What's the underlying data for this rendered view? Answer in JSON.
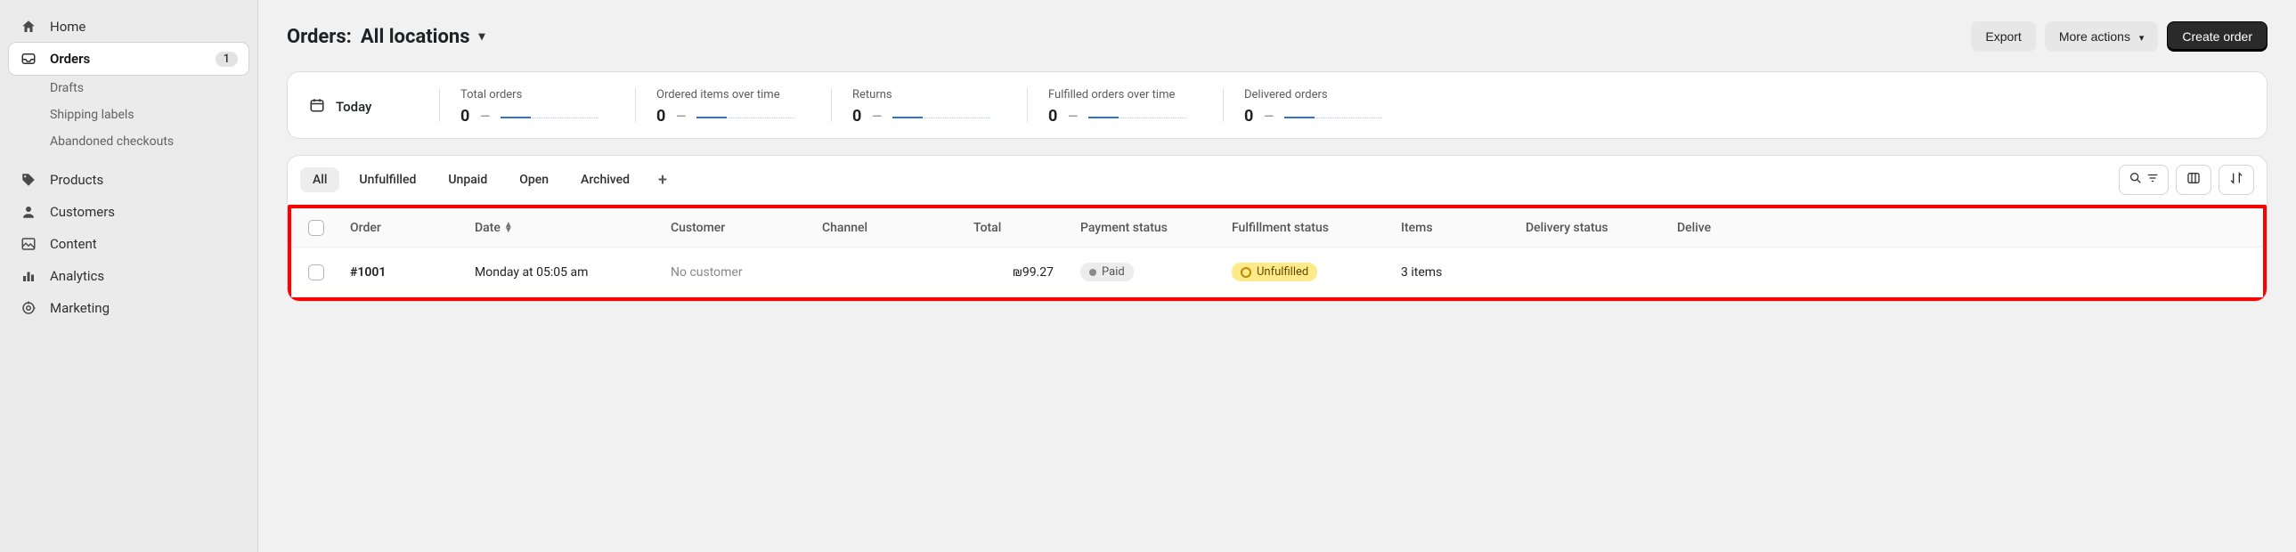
{
  "sidebar": {
    "items": [
      {
        "label": "Home"
      },
      {
        "label": "Orders",
        "badge": "1"
      },
      {
        "label": "Products"
      },
      {
        "label": "Customers"
      },
      {
        "label": "Content"
      },
      {
        "label": "Analytics"
      },
      {
        "label": "Marketing"
      }
    ],
    "orders_sub": [
      {
        "label": "Drafts"
      },
      {
        "label": "Shipping labels"
      },
      {
        "label": "Abandoned checkouts"
      }
    ]
  },
  "header": {
    "title_prefix": "Orders:",
    "title_scope": "All locations",
    "export": "Export",
    "more_actions": "More actions",
    "create_order": "Create order"
  },
  "metrics": {
    "today": "Today",
    "cards": [
      {
        "label": "Total orders",
        "value": "0",
        "delta": "—"
      },
      {
        "label": "Ordered items over time",
        "value": "0",
        "delta": "—"
      },
      {
        "label": "Returns",
        "value": "0",
        "delta": "—"
      },
      {
        "label": "Fulfilled orders over time",
        "value": "0",
        "delta": "—"
      },
      {
        "label": "Delivered orders",
        "value": "0",
        "delta": "—"
      }
    ]
  },
  "tabs": {
    "all": "All",
    "unfulfilled": "Unfulfilled",
    "unpaid": "Unpaid",
    "open": "Open",
    "archived": "Archived"
  },
  "columns": {
    "order": "Order",
    "date": "Date",
    "customer": "Customer",
    "channel": "Channel",
    "total": "Total",
    "payment_status": "Payment status",
    "fulfillment_status": "Fulfillment status",
    "items": "Items",
    "delivery_status": "Delivery status",
    "delivery": "Delive"
  },
  "rows": [
    {
      "order": "#1001",
      "date": "Monday at 05:05 am",
      "customer": "No customer",
      "channel": "",
      "total": "₪99.27",
      "payment_status": "Paid",
      "fulfillment_status": "Unfulfilled",
      "items": "3 items",
      "delivery_status": ""
    }
  ]
}
